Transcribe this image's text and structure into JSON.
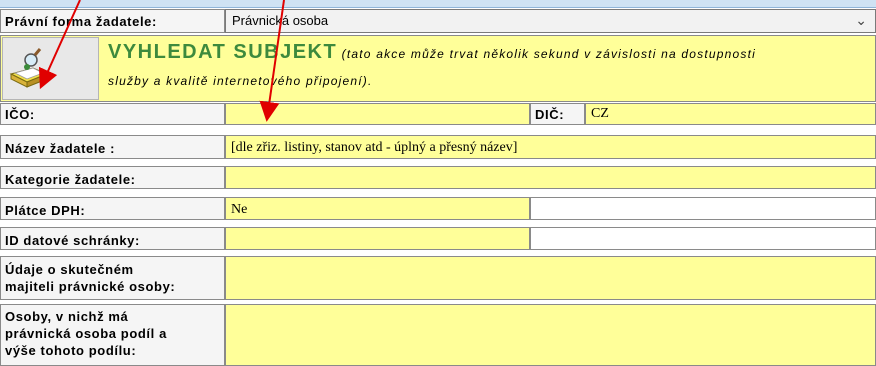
{
  "form": {
    "legal_form_label": "Právní forma žadatele:",
    "legal_form_value": "Právnická osoba",
    "search_title": "VYHLEDAT SUBJEKT",
    "search_note_line1": "(tato akce může trvat několik sekund v závislosti na dostupnosti",
    "search_note_line2": "služby a kvalitě internetového připojení).",
    "ico_label": "IČO:",
    "ico_value": "",
    "dic_label": "DIČ:",
    "dic_value": "CZ",
    "name_label": "Název žadatele :",
    "name_value": "[dle zřiz. listiny, stanov atd - úplný a přesný název]",
    "category_label": "Kategorie žadatele:",
    "category_value": "",
    "vat_label": "Plátce DPH:",
    "vat_value": "Ne",
    "databox_label": "ID datové schránky:",
    "databox_value": "",
    "owner_label_line1": "Údaje o skutečném",
    "owner_label_line2": "majiteli právnické osoby:",
    "owner_value": "",
    "share_label_line1": "Osoby, v nichž má",
    "share_label_line2": "právnická osoba podíl a",
    "share_label_line3": "výše tohoto podílu:",
    "share_value": ""
  },
  "colors": {
    "field_bg": "#ffff99",
    "title_green": "#3d8a3d",
    "arrow": "#e00000"
  },
  "icons": {
    "search_button": "book-magnifier-icon",
    "dropdown": "chevron-down-icon"
  }
}
